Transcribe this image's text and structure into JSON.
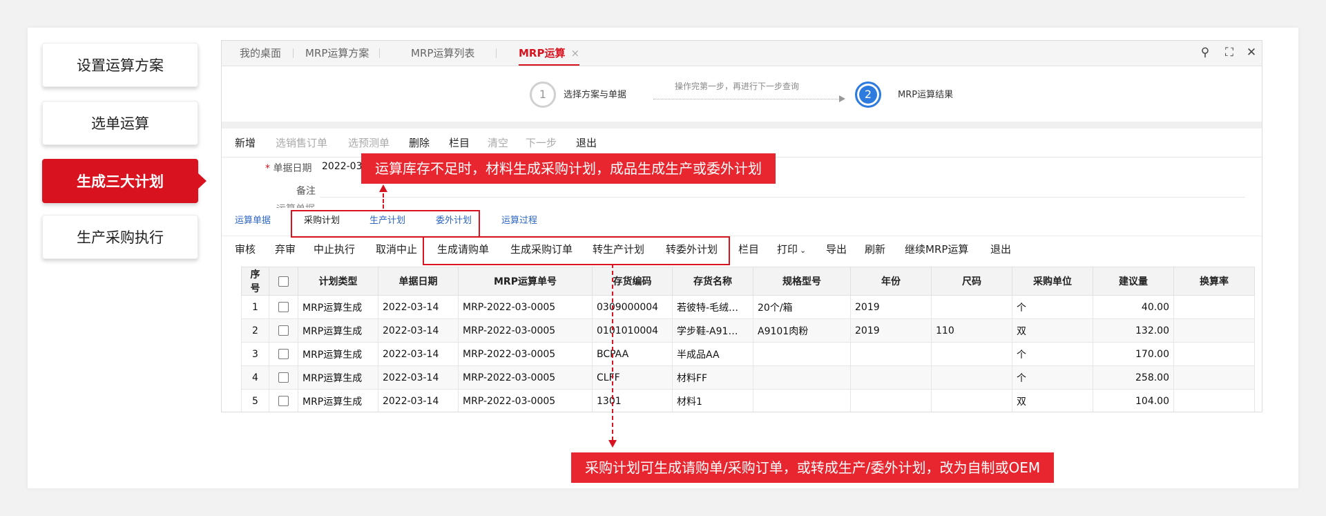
{
  "steps": [
    "设置运算方案",
    "选单运算",
    "生成三大计划",
    "生产采购执行"
  ],
  "tabs": [
    {
      "label": "我的桌面"
    },
    {
      "label": "MRP运算方案"
    },
    {
      "label": "MRP运算列表"
    },
    {
      "label": "MRP运算",
      "close": "×"
    }
  ],
  "window_icons": {
    "search": "⚲",
    "maximize": "⛶",
    "close": "✕"
  },
  "wizard": {
    "step1": {
      "num": "1",
      "label": "选择方案与单据"
    },
    "hint": "操作完第一步，再进行下一步查询",
    "step2": {
      "num": "2",
      "label": "MRP运算结果"
    }
  },
  "toolbar1": [
    {
      "label": "新增",
      "enabled": true
    },
    {
      "label": "选销售订单",
      "enabled": false
    },
    {
      "label": "选预测单",
      "enabled": false
    },
    {
      "label": "删除",
      "enabled": true
    },
    {
      "label": "栏目",
      "enabled": true
    },
    {
      "label": "清空",
      "enabled": false
    },
    {
      "label": "下一步",
      "enabled": false
    },
    {
      "label": "退出",
      "enabled": true
    }
  ],
  "form": {
    "date_label": "单据日期",
    "date_required": "*",
    "date_value": "2022-03",
    "remark_label": "备注",
    "partial_label": "运算单据"
  },
  "subtabs": [
    "运算单据",
    "采购计划",
    "生产计划",
    "委外计划",
    "运算过程"
  ],
  "toolbar2": [
    "审核",
    "弃审",
    "中止执行",
    "取消中止",
    "生成请购单",
    "生成采购订单",
    "转生产计划",
    "转委外计划",
    "栏目",
    "打印",
    "导出",
    "刷新",
    "继续MRP运算",
    "退出"
  ],
  "print_caret": "⌄",
  "table": {
    "headers": [
      "序号",
      "",
      "计划类型",
      "单据日期",
      "MRP运算单号",
      "存货编码",
      "存货名称",
      "规格型号",
      "年份",
      "尺码",
      "采购单位",
      "建议量",
      "换算率"
    ],
    "rows": [
      [
        "1",
        "MRP运算生成",
        "2022-03-14",
        "MRP-2022-03-0005",
        "0309000004",
        "若彼特-毛绒…",
        "20个/箱",
        "2019",
        "",
        "个",
        "40.00",
        ""
      ],
      [
        "2",
        "MRP运算生成",
        "2022-03-14",
        "MRP-2022-03-0005",
        "0101010004",
        "学步鞋-A91…",
        "A9101肉粉",
        "2019",
        "110",
        "双",
        "132.00",
        ""
      ],
      [
        "3",
        "MRP运算生成",
        "2022-03-14",
        "MRP-2022-03-0005",
        "BCPAA",
        "半成品AA",
        "",
        "",
        "",
        "个",
        "170.00",
        ""
      ],
      [
        "4",
        "MRP运算生成",
        "2022-03-14",
        "MRP-2022-03-0005",
        "CLFF",
        "材料FF",
        "",
        "",
        "",
        "个",
        "258.00",
        ""
      ],
      [
        "5",
        "MRP运算生成",
        "2022-03-14",
        "MRP-2022-03-0005",
        "1301",
        "材料1",
        "",
        "",
        "",
        "双",
        "104.00",
        ""
      ]
    ]
  },
  "callouts": {
    "top": "运算库存不足时，材料生成采购计划，成品生成生产或委外计划",
    "bottom": "采购计划可生成请购单/采购订单，或转成生产/委外计划，改为自制或OEM"
  },
  "colors": {
    "brand_red": "#d8121e",
    "callout_red": "#e8262f",
    "link_blue": "#2e66c5",
    "step_blue": "#2e7be0"
  }
}
